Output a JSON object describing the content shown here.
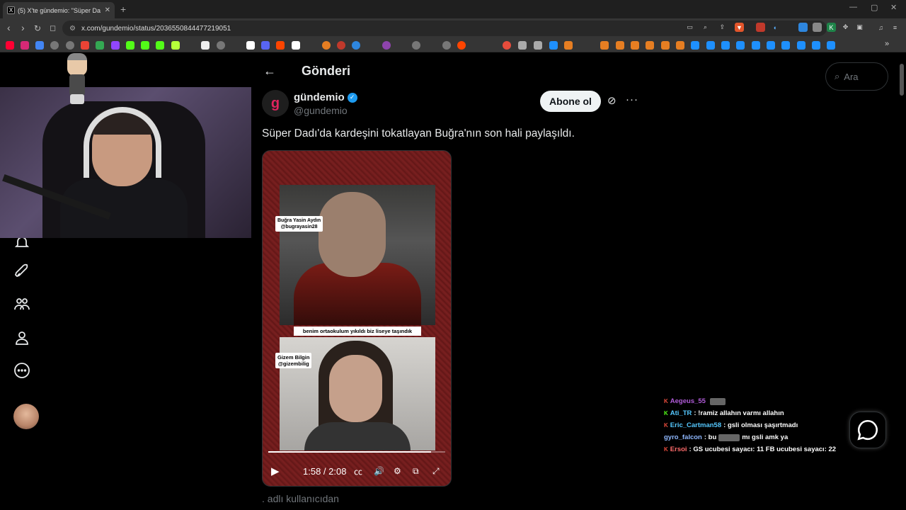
{
  "browser": {
    "tab_title": "(5) X'te gündemio: \"Süper Da",
    "tab_favicon": "X",
    "url": "x.com/gundemio/status/2036550844477219051"
  },
  "header": {
    "title": "Gönderi"
  },
  "search": {
    "placeholder": "Ara"
  },
  "tweet": {
    "author_name": "gündemio",
    "author_handle": "@gundemio",
    "avatar_letter": "g",
    "subscribe_label": "Abone ol",
    "text": "Süper Dadı'da kardeşini tokatlayan Buğra'nın son hali paylaşıldı.",
    "reply_text": ". adlı kullanıcıdan"
  },
  "video": {
    "label_top": "Buğra Yasin Aydın\n@bugrayasin28",
    "label_top_name": "Buğra Yasin Aydın",
    "label_top_handle": "@bugrayasin28",
    "caption": "benim ortaokulum yıkıldı biz liseye taşındık",
    "label_bottom_name": "Gizem Bilgin",
    "label_bottom_handle": "@gizembilig",
    "time": "1:58 / 2:08",
    "progress": 0.92
  },
  "chat": {
    "messages": [
      {
        "user": "Aegeus_55",
        "text": "",
        "user_color": "#b05bd8",
        "badge": "K"
      },
      {
        "user": "Ati_TR",
        "text": ": !ramiz allahın varmı allahın",
        "user_color": "#55c8ff",
        "badge": "K"
      },
      {
        "user": "Eric_Cartman58",
        "text": ": gsli olması şaşırtmadı",
        "user_color": "#55c8ff",
        "badge": "K"
      },
      {
        "user": "gyro_falcon",
        "text": ": bu",
        "text2": "mı gsli amk ya",
        "user_color": "#8fb8ff",
        "badge": ""
      },
      {
        "user": "Ersoi",
        "text": ": GS ucubesi sayacı: 11 FB ucubesi sayacı: 22",
        "user_color": "#ff6b6b",
        "badge": "K"
      }
    ]
  },
  "colors": {
    "accent": "#1d9bf0",
    "background": "#000000"
  }
}
